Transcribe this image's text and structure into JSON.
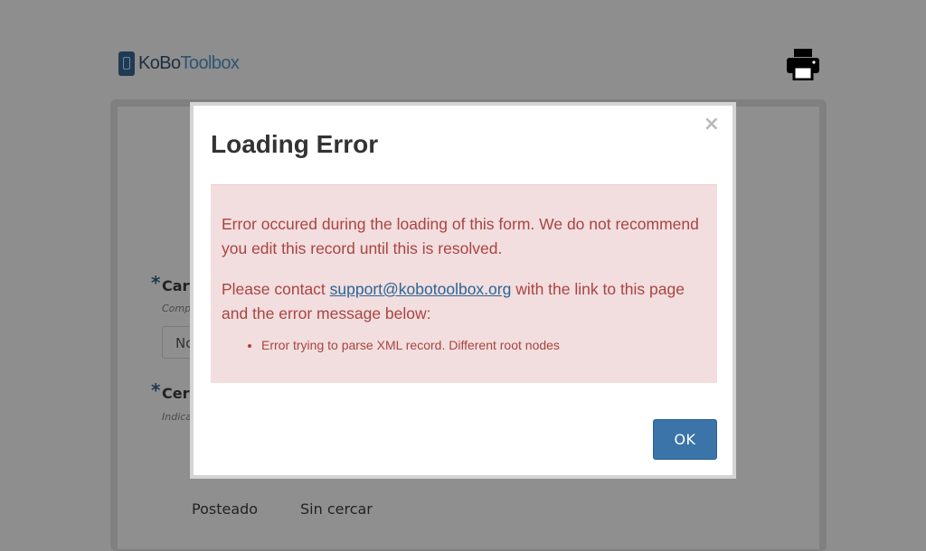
{
  "header": {
    "logo_ko": "KoBo",
    "logo_toolbox": "Toolbox",
    "print_icon": "printer-icon"
  },
  "form": {
    "question1_label": "Cart",
    "question1_hint": "Comp",
    "question1_input_value": "No",
    "question2_label": "Cerc",
    "question2_hint": "Indica",
    "options": [
      "Posteado",
      "Sin cercar"
    ]
  },
  "modal": {
    "title": "Loading Error",
    "close_label": "×",
    "message1": "Error occured during the loading of this form. We do not recommend you edit this record until this is resolved.",
    "message2_before": "Please contact ",
    "support_email": "support@kobotoolbox.org",
    "message2_after": " with the link to this page and the error message below:",
    "errors": [
      "Error trying to parse XML record. Different root nodes"
    ],
    "ok_label": "OK"
  },
  "colors": {
    "overlay": "#8e8e8e",
    "alert_bg": "#f2dede",
    "alert_text": "#a94442",
    "link": "#2a6496",
    "primary": "#3a74a9"
  }
}
